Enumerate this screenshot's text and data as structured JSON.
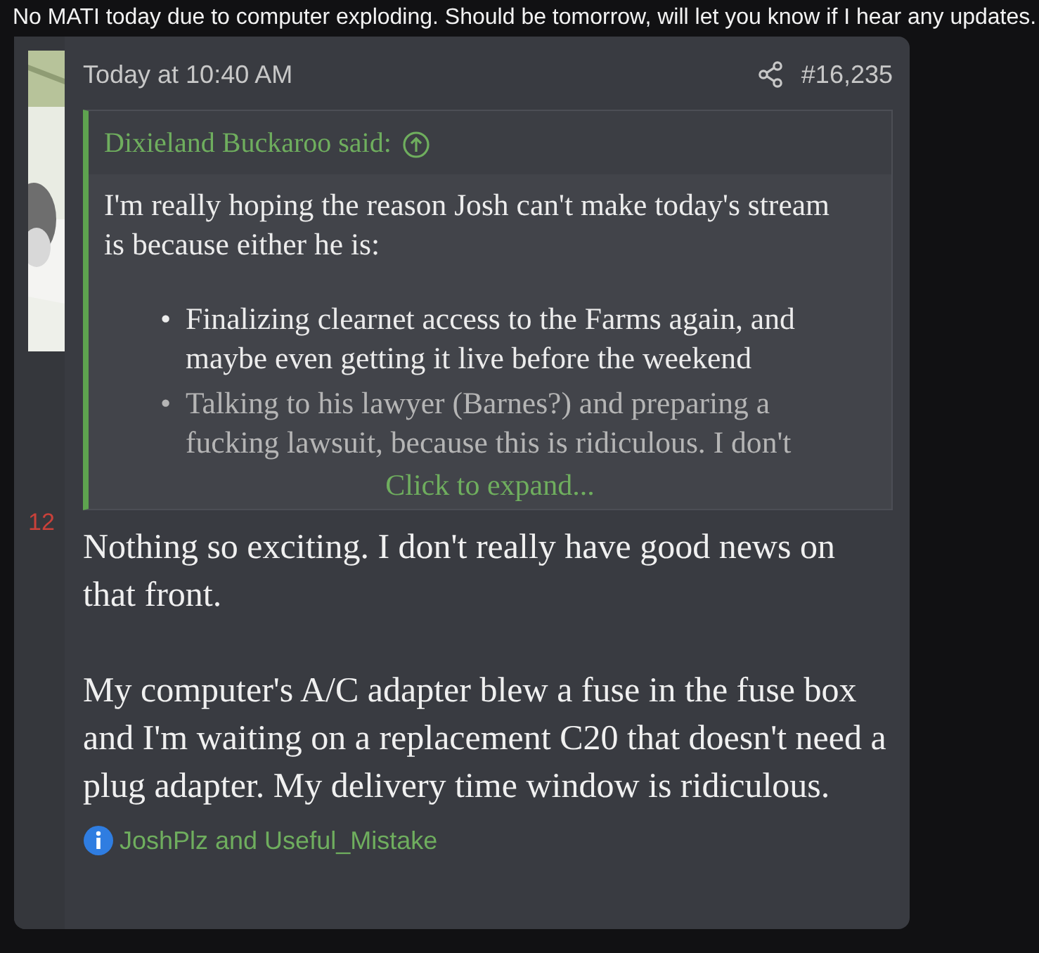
{
  "caption": "No MATI today due to computer exploding. Should be tomorrow, will let you know if I hear any updates.",
  "post": {
    "author_fragment": "12",
    "timestamp": "Today at 10:40 AM",
    "number": "#16,235",
    "quote": {
      "attribution": "Dixieland Buckaroo said:",
      "intro": "I'm really hoping the reason Josh can't make today's stream is because either he is:",
      "bullets": [
        {
          "marker": "•",
          "text": "Finalizing clearnet access to the Farms again, and maybe even getting it live before the weekend"
        },
        {
          "marker": "•",
          "text": "Talking to his lawyer (Barnes?) and preparing a fucking lawsuit, because this is ridiculous. I don't"
        }
      ],
      "expand": "Click to expand..."
    },
    "paragraphs": [
      "Nothing so exciting. I don't really have good news on that front.",
      "My computer's A/C adapter blew a fuse in the fuse box and I'm waiting on a replacement C20 that doesn't need a plug adapter. My delivery time window is ridiculous."
    ],
    "reactions": "JoshPlz and Useful_Mistake"
  }
}
